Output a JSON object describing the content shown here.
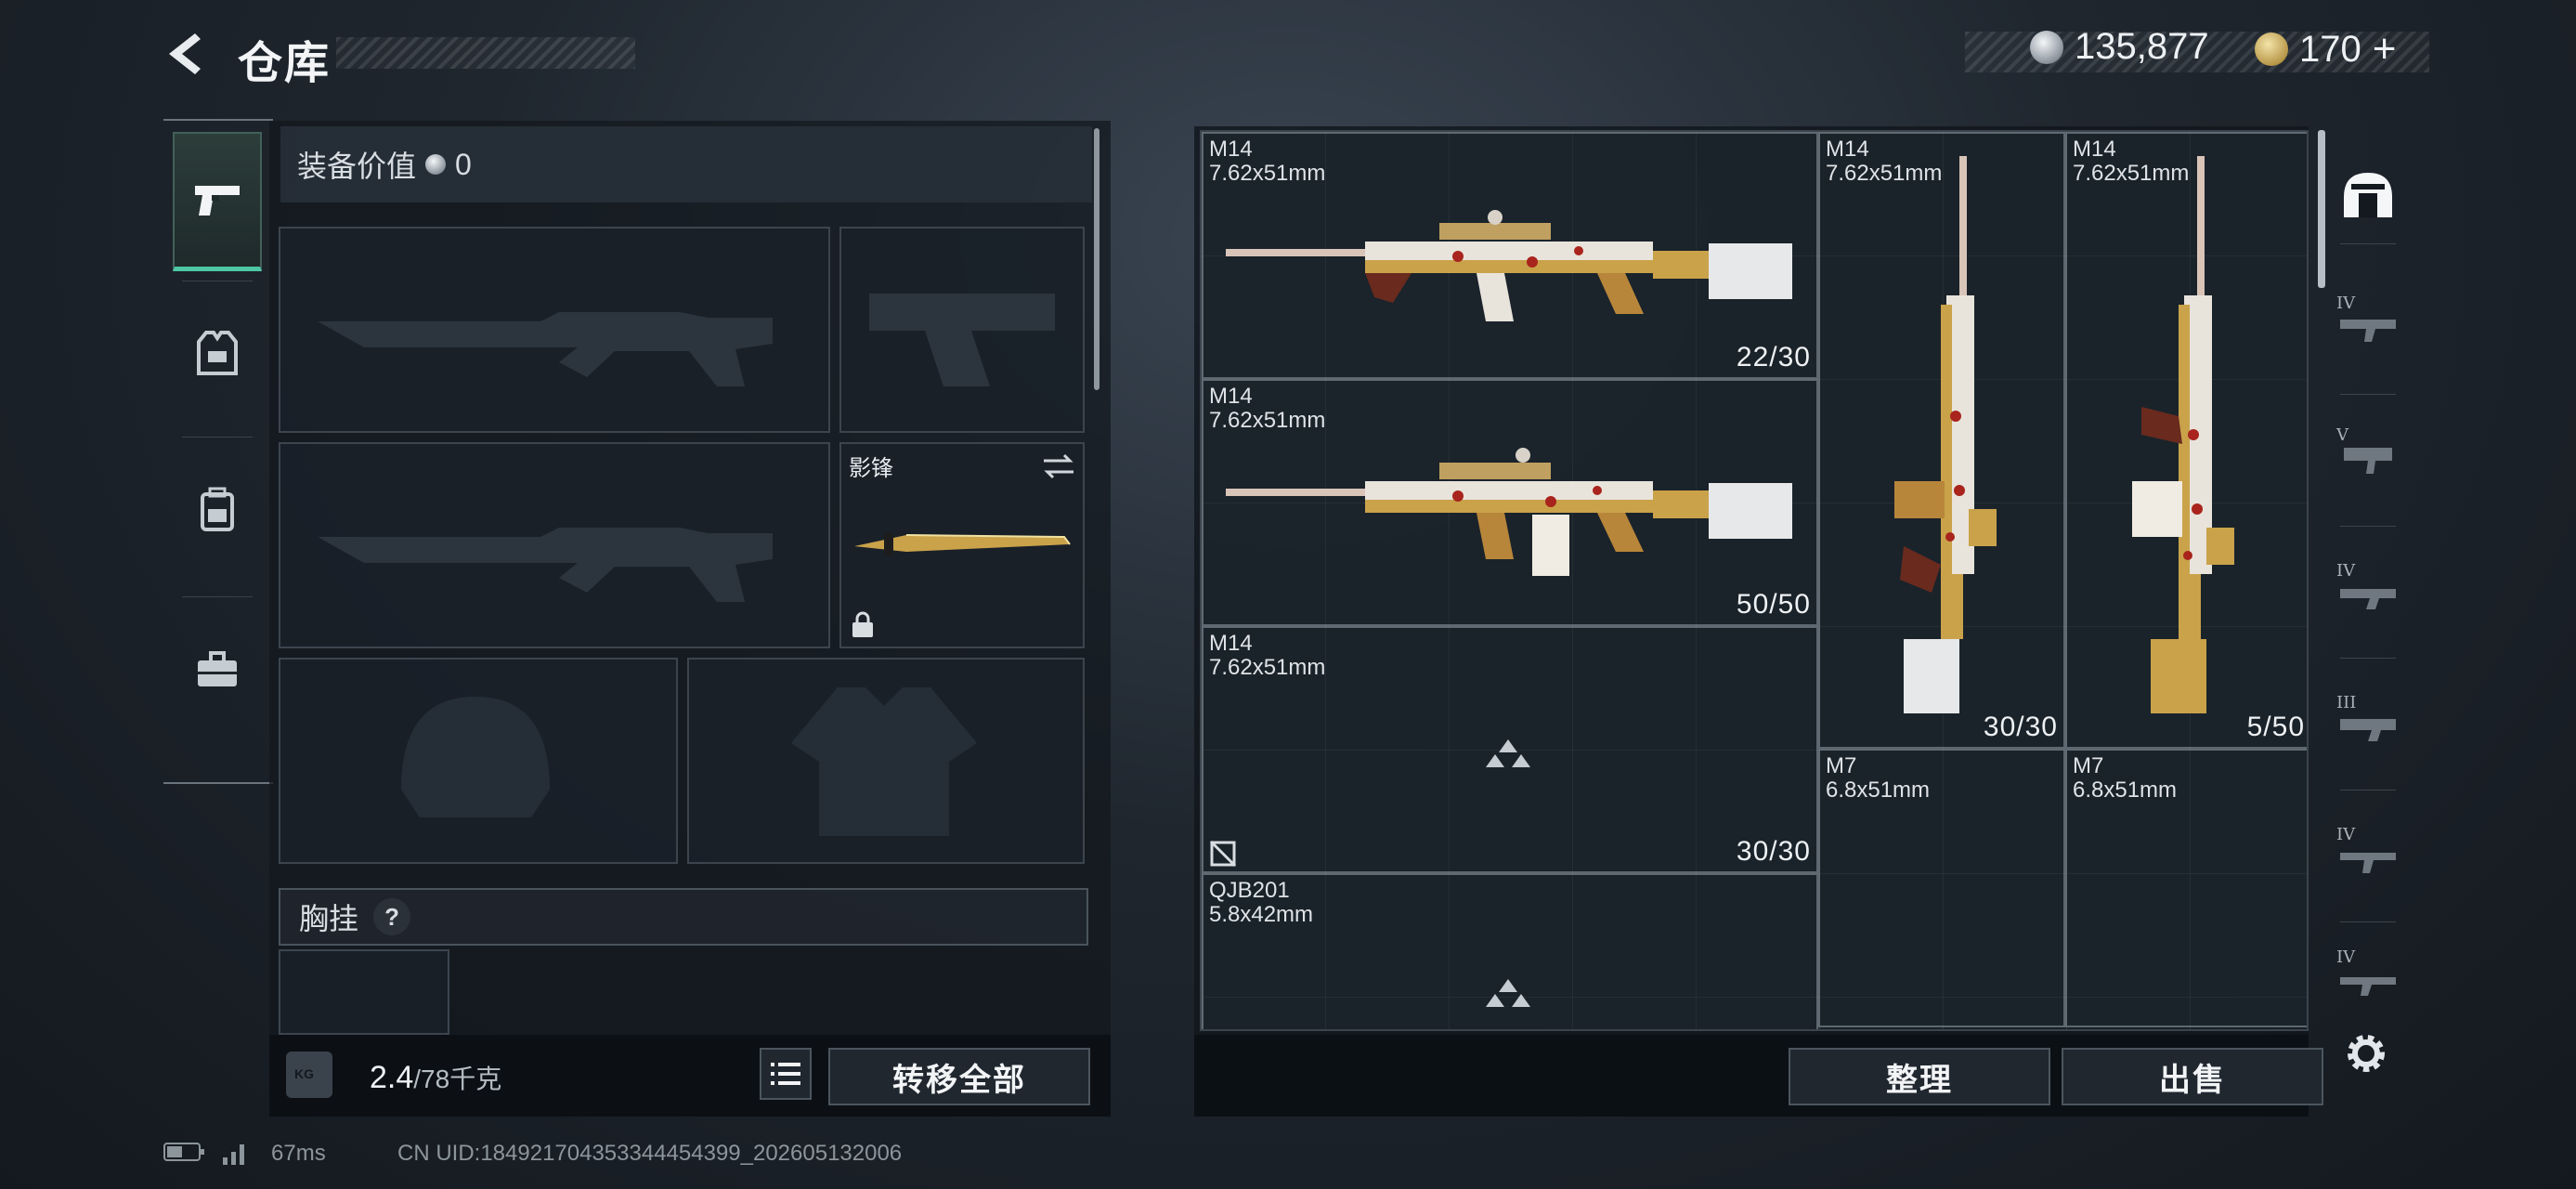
{
  "header": {
    "title": "仓库",
    "currency_silver": "135,877",
    "currency_gold": "170",
    "add_label": "+"
  },
  "categories": [
    {
      "name": "firearms",
      "icon": "pistol-icon",
      "active": true
    },
    {
      "name": "armor",
      "icon": "armor-vest-icon",
      "active": false
    },
    {
      "name": "backpack",
      "icon": "backpack-icon",
      "active": false
    },
    {
      "name": "tools",
      "icon": "toolbox-icon",
      "active": false
    }
  ],
  "loadout": {
    "value_label": "装备价值",
    "value": "0",
    "melee_label": "影锋",
    "chest_label": "胸挂",
    "chest_help": "?",
    "weight_current": "2.4",
    "weight_max": "/78千克",
    "weight_icon_text": "KG",
    "transfer_all": "转移全部"
  },
  "warehouse": {
    "items": [
      {
        "name": "M14",
        "caliber": "7.62x51mm",
        "ammo": "22/30"
      },
      {
        "name": "M14",
        "caliber": "7.62x51mm",
        "ammo": "50/50"
      },
      {
        "name": "M14",
        "caliber": "7.62x51mm",
        "ammo": "30/30"
      },
      {
        "name": "M14",
        "caliber": "7.62x51mm",
        "ammo": "30/30"
      },
      {
        "name": "M14",
        "caliber": "7.62x51mm",
        "ammo": "5/50"
      },
      {
        "name": "M7",
        "caliber": "6.8x51mm",
        "ammo": ""
      },
      {
        "name": "M7",
        "caliber": "6.8x51mm",
        "ammo": ""
      },
      {
        "name": "QJB201",
        "caliber": "5.8x42mm",
        "ammo": ""
      }
    ],
    "sort_button": "整理",
    "sell_button": "出售"
  },
  "filters": [
    {
      "tier": "",
      "icon": "all-items-icon"
    },
    {
      "tier": "IV",
      "icon": "assault-rifle-icon"
    },
    {
      "tier": "V",
      "icon": "submachine-gun-icon"
    },
    {
      "tier": "IV",
      "icon": "shotgun-icon"
    },
    {
      "tier": "III",
      "icon": "light-machine-gun-icon"
    },
    {
      "tier": "IV",
      "icon": "marksman-rifle-icon"
    },
    {
      "tier": "IV",
      "icon": "sniper-rifle-icon"
    }
  ],
  "status": {
    "ping": "67ms",
    "uid": "CN UID:184921704353344454399_202605132006"
  },
  "colors": {
    "accent": "#4ec7a4",
    "gold_skin": "#c9a24a",
    "panel": "#1a2129"
  }
}
